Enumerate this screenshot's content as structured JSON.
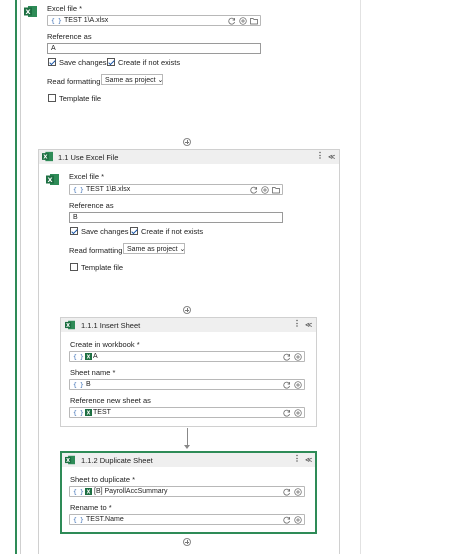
{
  "colors": {
    "accent": "#2e8b57",
    "excel_green": "#1d6f42",
    "link_blue": "#3b6fb6"
  },
  "top_block": {
    "excel_file_label": "Excel file",
    "excel_file_value": "TEST 1\\A.xlsx",
    "reference_label": "Reference as",
    "reference_value": "A",
    "save_changes": "Save changes",
    "create_if_not_exists": "Create if not exists",
    "read_formatting_label": "Read formatting",
    "read_formatting_value": "Same as project",
    "template_file": "Template file"
  },
  "use_excel": {
    "title": "1.1 Use Excel File",
    "excel_file_label": "Excel file",
    "excel_file_value": "TEST 1\\B.xlsx",
    "reference_label": "Reference as",
    "reference_value": "B",
    "save_changes": "Save changes",
    "create_if_not_exists": "Create if not exists",
    "read_formatting_label": "Read formatting",
    "read_formatting_value": "Same as project",
    "template_file": "Template file"
  },
  "insert_sheet": {
    "title": "1.1.1  Insert Sheet",
    "workbook_label": "Create in workbook",
    "workbook_value": "A",
    "sheet_name_label": "Sheet name",
    "sheet_name_value": "B",
    "ref_label": "Reference new sheet as",
    "ref_value": "TEST"
  },
  "duplicate_sheet": {
    "title": "1.1.2  Duplicate Sheet",
    "sheet_label": "Sheet to duplicate",
    "sheet_value": "[B] PayrollAccSummary",
    "rename_label": "Rename to",
    "rename_value": "TEST.Name"
  },
  "common": {
    "required": "*",
    "brace": "{ }",
    "kebab": "⋮",
    "collapse": "⌃"
  }
}
